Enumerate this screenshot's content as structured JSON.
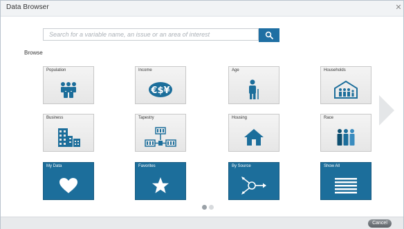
{
  "window": {
    "title": "Data Browser"
  },
  "search": {
    "placeholder": "Search for a variable name, an issue or an area of interest"
  },
  "browse_label": "Browse",
  "tiles": [
    {
      "label": "Population",
      "icon": "population-icon"
    },
    {
      "label": "Income",
      "icon": "currency-icon"
    },
    {
      "label": "Age",
      "icon": "elderly-person-icon"
    },
    {
      "label": "Households",
      "icon": "household-icon"
    },
    {
      "label": "Business",
      "icon": "buildings-icon"
    },
    {
      "label": "Tapestry",
      "icon": "tapestry-icon"
    },
    {
      "label": "Housing",
      "icon": "house-icon"
    },
    {
      "label": "Race",
      "icon": "race-people-icon"
    },
    {
      "label": "My Data",
      "icon": "heart-icon"
    },
    {
      "label": "Favorites",
      "icon": "star-icon"
    },
    {
      "label": "By Source",
      "icon": "source-icon"
    },
    {
      "label": "Show All",
      "icon": "list-icon"
    }
  ],
  "pager": {
    "pages": 2,
    "current": 1
  },
  "footer": {
    "cancel_label": "Cancel"
  },
  "colors": {
    "accent": "#1c6e9b",
    "search_button": "#1f6fa3",
    "tile_light": "#ececec",
    "footer": "#e8eaec"
  }
}
